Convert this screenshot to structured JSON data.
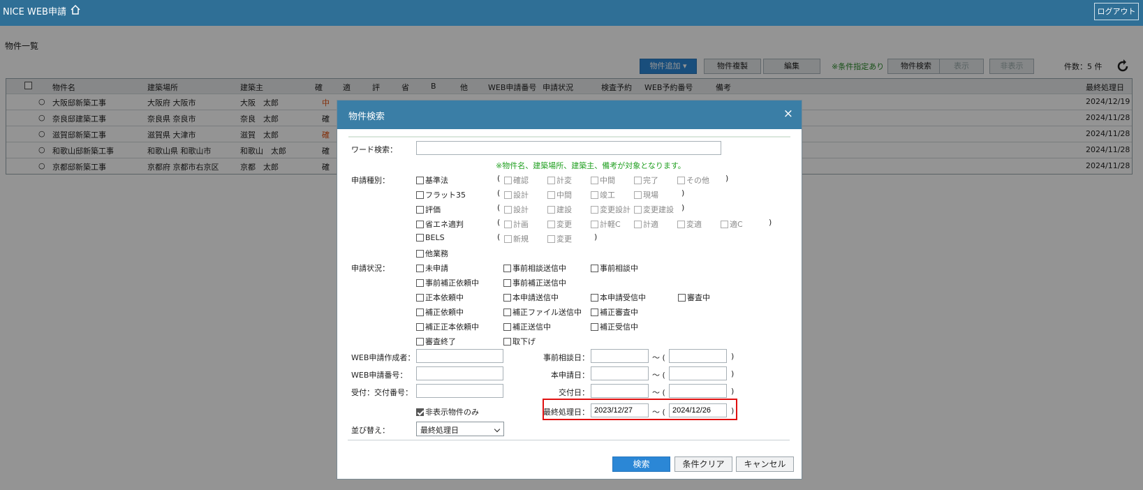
{
  "header": {
    "app_title": "NICE WEB申請",
    "logout_label": "ログアウト"
  },
  "page": {
    "title": "物件一覧"
  },
  "toolbar": {
    "add_label": "物件追加 ▾",
    "copy_label": "物件複製",
    "edit_label": "編集",
    "condition_note": "※条件指定あり",
    "search_label": "物件検索",
    "show_label": "表示",
    "hide_label": "非表示",
    "count_label": "件数：5 件"
  },
  "grid": {
    "headers": [
      "物件名",
      "建築場所",
      "建築主",
      "確",
      "適",
      "評",
      "省",
      "B",
      "他",
      "WEB申請番号",
      "申請状況",
      "検査予約",
      "WEB予約番号",
      "備考",
      "最終処理日"
    ],
    "rows": [
      {
        "name": "大阪邸新築工事",
        "place": "大阪府 大阪市",
        "owner": "大阪　太郎",
        "kaku": "中",
        "date": "2024/12/19"
      },
      {
        "name": "奈良邸建築工事",
        "place": "奈良県 奈良市",
        "owner": "奈良　太郎",
        "kaku": "確",
        "date": "2024/11/28"
      },
      {
        "name": "滋賀邸新築工事",
        "place": "滋賀県 大津市",
        "owner": "滋賀　太郎",
        "kaku": "確",
        "date": "2024/11/28"
      },
      {
        "name": "和歌山邸新築工事",
        "place": "和歌山県 和歌山市",
        "owner": "和歌山　太郎",
        "kaku": "確",
        "date": "2024/11/28"
      },
      {
        "name": "京都邸新築工事",
        "place": "京都府 京都市右京区",
        "owner": "京都　太郎",
        "kaku": "確",
        "date": "2024/11/28"
      }
    ]
  },
  "dialog": {
    "title": "物件検索",
    "close": "×",
    "word_label": "ワード検索：",
    "word_value": "",
    "word_note": "※物件名、建築場所、建築主、備考が対象となります。",
    "type_label": "申請種別：",
    "types": [
      {
        "label": "基準法",
        "subs": [
          "確認",
          "計変",
          "中間",
          "完了",
          "その他"
        ]
      },
      {
        "label": "フラット35",
        "subs": [
          "設計",
          "中間",
          "竣工",
          "現場"
        ]
      },
      {
        "label": "評価",
        "subs": [
          "設計",
          "建設",
          "変更設計",
          "変更建設"
        ]
      },
      {
        "label": "省エネ適判",
        "subs": [
          "計画",
          "変更",
          "計軽C",
          "計適",
          "変適",
          "適C"
        ]
      },
      {
        "label": "BELS",
        "subs": [
          "新規",
          "変更"
        ]
      },
      {
        "label": "他業務",
        "subs": []
      }
    ],
    "paren_open": "(",
    "paren_close": ")",
    "status_label": "申請状況：",
    "status_rows": [
      [
        "未申請",
        "事前相談送信中",
        "事前相談中"
      ],
      [
        "事前補正依頼中",
        "事前補正送信中"
      ],
      [
        "正本依頼中",
        "本申請送信中",
        "本申請受信中",
        "審査中"
      ],
      [
        "補正依頼中",
        "補正ファイル送信中",
        "補正審査中"
      ],
      [
        "補正正本依頼中",
        "補正送信中",
        "補正受信中"
      ],
      [
        "審査終了",
        "取下げ"
      ]
    ],
    "creator_label": "WEB申請作成者：",
    "webno_label": "WEB申請番号：",
    "receipt_label": "受付：交付番号：",
    "hidden_only_label": "非表示物件のみ",
    "sort_label": "並び替え：",
    "sort_value": "最終処理日",
    "pre_date_label": "事前相談日：",
    "main_date_label": "本申請日：",
    "issue_date_label": "交付日：",
    "last_date_label": "最終処理日：",
    "last_date_from": "2023/12/27",
    "last_date_to": "2024/12/26",
    "range_sep": "～ (",
    "range_end": ")",
    "search_button": "検索",
    "clear_button": "条件クリア",
    "cancel_button": "キャンセル"
  },
  "colors": {
    "header_bg": "#2f6f96",
    "dialog_head": "#3a7ea6",
    "primary": "#2b87d6",
    "note_green": "#22a022",
    "highlight": "#e01010"
  }
}
